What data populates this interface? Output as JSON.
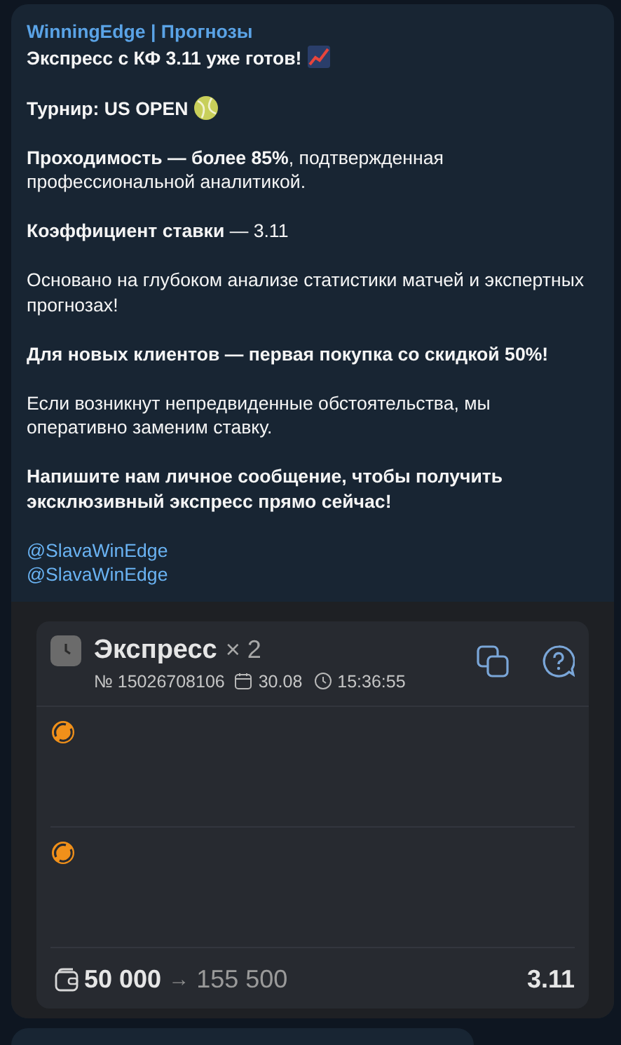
{
  "channel": {
    "name": "WinningEdge | Прогнозы"
  },
  "message": {
    "paragraphs": [
      {
        "text": "Экспресс с КФ 3.11 уже готов!",
        "bold": true
      },
      {
        "text": "Турнир: US OPEN",
        "bold": true
      },
      {
        "text": "**Проходимость — более 85%**, подтвержденная профессиональной аналитикой.",
        "bold": false
      },
      {
        "text": "**Коэффициент ставки** — 3.11",
        "bold": false
      },
      {
        "text": "Основано на глубоком анализе статистики матчей и экспертных прогнозах!",
        "bold": false
      },
      {
        "text": "Для новых клиентов — первая покупка со скидкой 50%!",
        "bold": true
      },
      {
        "text": "Если возникнут непредвиденные обстоятельства, мы оперативно заменим ставку.",
        "bold": false
      },
      {
        "text": "Напишите нам личное сообщение, чтобы получить эксклюзивный экспресс прямо сейчас!",
        "bold": true
      }
    ],
    "mentions": [
      "@SlavaWinEdge",
      "@SlavaWinEdge"
    ]
  },
  "bet_slip": {
    "title": "Экспресс",
    "multiplier": "× 2",
    "number": "№ 15026708106",
    "date": "30.08",
    "time": "15:36:55",
    "events": [
      {
        "kind": "tennis"
      },
      {
        "kind": "tennis"
      }
    ],
    "stake": "50 000",
    "arrow": "→",
    "payout": "155 500",
    "odds": "3.11"
  }
}
